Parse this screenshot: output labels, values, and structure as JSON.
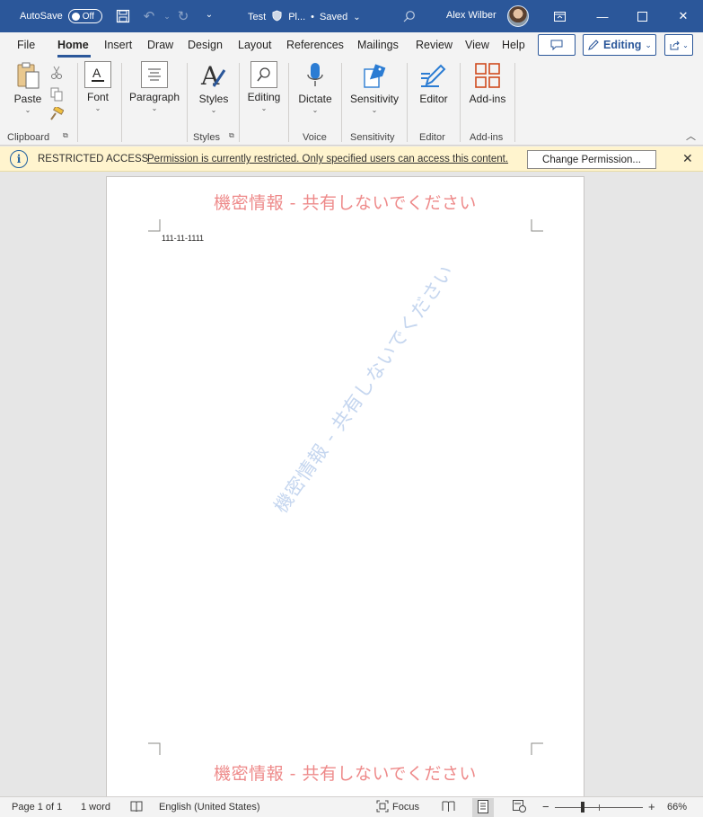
{
  "titlebar": {
    "autosave_label": "AutoSave",
    "autosave_state": "Off",
    "doc_name": "Test",
    "label_abbrev": "Pl...",
    "save_status": "Saved",
    "user_name": "Alex Wilber",
    "bg_color": "#2b579a"
  },
  "tabs": [
    "File",
    "Home",
    "Insert",
    "Draw",
    "Design",
    "Layout",
    "References",
    "Mailings",
    "Review",
    "View",
    "Help"
  ],
  "active_tab": "Home",
  "mode_button": "Editing",
  "ribbon": {
    "paste": "Paste",
    "clipboard": "Clipboard",
    "font": "Font",
    "paragraph": "Paragraph",
    "styles": "Styles",
    "styles_group": "Styles",
    "editing": "Editing",
    "dictate": "Dictate",
    "voice_group": "Voice",
    "sensitivity": "Sensitivity",
    "sensitivity_group": "Sensitivity",
    "editor": "Editor",
    "editor_group": "Editor",
    "addins": "Add-ins",
    "addins_group": "Add-ins"
  },
  "message_bar": {
    "title": "RESTRICTED ACCESS",
    "text": "Permission is currently restricted. Only specified users can access this content.",
    "button": "Change Permission...",
    "bg_color": "#fff4ce"
  },
  "document": {
    "header_watermark": "機密情報 - 共有しないでください",
    "footer_watermark": "機密情報 - 共有しないでください",
    "diagonal_watermark": "機密情報 - 共有しないでください",
    "body_text": "111-11-1111",
    "watermark_color": "#ee8a8a"
  },
  "statusbar": {
    "page": "Page 1 of 1",
    "words": "1 word",
    "language": "English (United States)",
    "focus": "Focus",
    "zoom_minus": "−",
    "zoom_plus": "+",
    "zoom": "66%"
  }
}
